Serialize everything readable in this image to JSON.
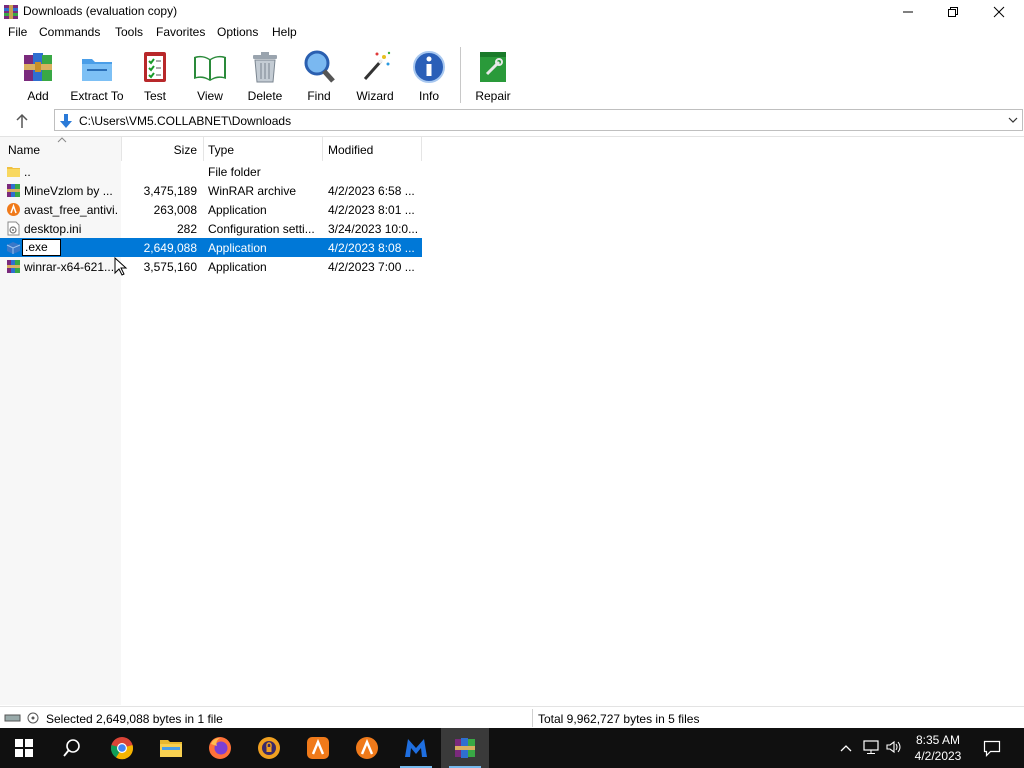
{
  "window": {
    "title": "Downloads (evaluation copy)",
    "controls": [
      "minimize",
      "restore",
      "close"
    ]
  },
  "menu": [
    "File",
    "Commands",
    "Tools",
    "Favorites",
    "Options",
    "Help"
  ],
  "toolbar": {
    "buttons": [
      {
        "label": "Add",
        "icon": "add-archive-icon"
      },
      {
        "label": "Extract To",
        "icon": "extract-folder-icon"
      },
      {
        "label": "Test",
        "icon": "test-clipboard-icon"
      },
      {
        "label": "View",
        "icon": "view-book-icon"
      },
      {
        "label": "Delete",
        "icon": "trash-icon"
      },
      {
        "label": "Find",
        "icon": "magnifier-icon"
      },
      {
        "label": "Wizard",
        "icon": "magic-wand-icon"
      },
      {
        "label": "Info",
        "icon": "info-icon"
      },
      {
        "label": "Repair",
        "icon": "repair-kit-icon"
      }
    ]
  },
  "address": {
    "path": "C:\\Users\\VM5.COLLABNET\\Downloads"
  },
  "columns": {
    "name": "Name",
    "size": "Size",
    "type": "Type",
    "modified": "Modified"
  },
  "files": [
    {
      "name": "..",
      "size": "",
      "type": "File folder",
      "modified": "",
      "icon": "folder-icon"
    },
    {
      "name": "MineVzlom by ...",
      "size": "3,475,189",
      "type": "WinRAR archive",
      "modified": "4/2/2023 6:58 ...",
      "icon": "rar-archive-icon"
    },
    {
      "name": "avast_free_antivi...",
      "size": "263,008",
      "type": "Application",
      "modified": "4/2/2023 8:01 ...",
      "icon": "avast-icon"
    },
    {
      "name": "desktop.ini",
      "size": "282",
      "type": "Configuration setti...",
      "modified": "3/24/2023 10:0...",
      "icon": "settings-file-icon"
    },
    {
      "name": ".exe",
      "size": "2,649,088",
      "type": "Application",
      "modified": "4/2/2023 8:08 ...",
      "icon": "exe-icon",
      "selected": true,
      "renaming": true
    },
    {
      "name": "winrar-x64-621....",
      "size": "3,575,160",
      "type": "Application",
      "modified": "4/2/2023 7:00 ...",
      "icon": "winrar-icon"
    }
  ],
  "status": {
    "selected": "Selected 2,649,088 bytes in 1 file",
    "total": "Total 9,962,727 bytes in 5 files"
  },
  "taskbar": {
    "apps": [
      "start-icon",
      "search-icon",
      "chrome-icon",
      "file-explorer-icon",
      "firefox-icon",
      "privacy-browser-icon",
      "avast-icon",
      "avast-secure-browser-icon",
      "malwarebytes-icon",
      "winrar-icon"
    ],
    "time": "8:35 AM",
    "date": "4/2/2023"
  },
  "colors": {
    "selection": "#0078d7",
    "taskbar": "#101010"
  }
}
